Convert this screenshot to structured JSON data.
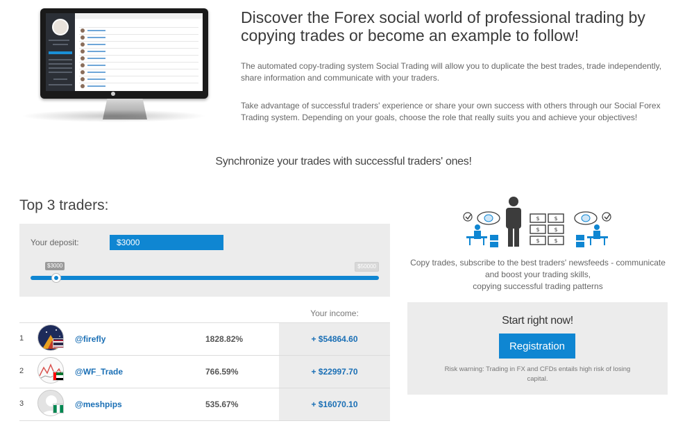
{
  "hero": {
    "title": "Discover the Forex social world of professional trading by copying trades or become an example to follow!",
    "paragraph1": "The automated copy-trading system Social Trading will allow you to duplicate the best trades, trade independently, share information and communicate with your traders.",
    "paragraph2": "Take advantage of successful traders' experience or share your own success with others through our Social Forex Trading system. Depending on your goals, choose the role that really suits you and achieve your objectives!"
  },
  "sync_text": "Synchronize your trades with successful traders' ones!",
  "traders": {
    "title": "Top 3 traders:",
    "deposit_label": "Your deposit:",
    "deposit_value": "$3000",
    "slider_min_label": "$3000",
    "slider_max_label": "$50000",
    "slider_position": 0.0,
    "income_header": "Your income:",
    "rows": [
      {
        "rank": "1",
        "nick": "@firefly",
        "percent": "1828.82%",
        "income": "+ $54864.60",
        "avatar": "night-sky-avatar",
        "flag": "thailand-flag"
      },
      {
        "rank": "2",
        "nick": "@WF_Trade",
        "percent": "766.59%",
        "income": "+ $22997.70",
        "avatar": "chart-avatar",
        "flag": "uae-flag"
      },
      {
        "rank": "3",
        "nick": "@meshpips",
        "percent": "535.67%",
        "income": "+ $16070.10",
        "avatar": "default-user-avatar",
        "flag": "nigeria-flag"
      }
    ]
  },
  "promo": {
    "copy_line1": "Copy trades, subscribe to the best traders' newsfeeds - communicate",
    "copy_line2": "and boost your trading skills,",
    "copy_line3": "copying successful trading patterns",
    "start_title": "Start right now!",
    "register_label": "Registration",
    "risk_warning": "Risk warning: Trading in FX and CFDs entails high risk of losing capital."
  },
  "colors": {
    "accent": "#0f86d2",
    "link": "#1a6fb5",
    "panel": "#ececec",
    "illustration": "#3c3c3c"
  }
}
